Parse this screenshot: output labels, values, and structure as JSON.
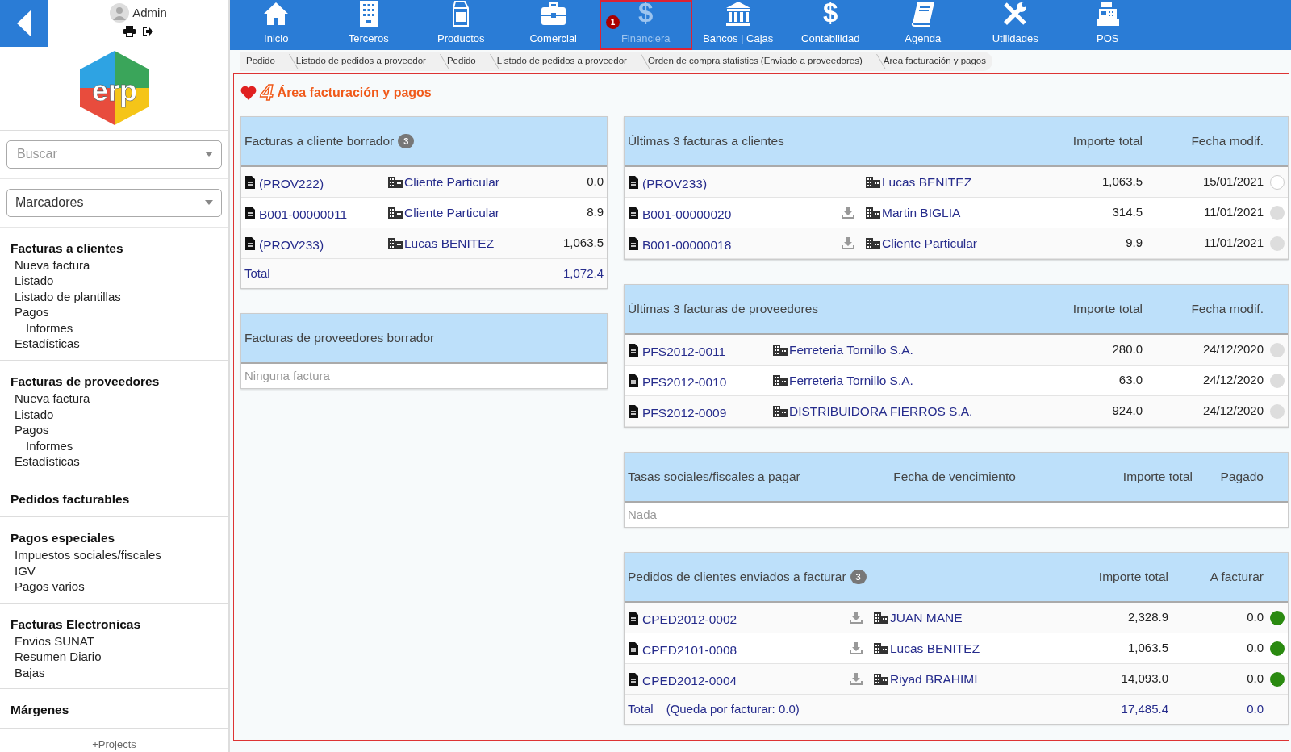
{
  "user": {
    "name": "Admin"
  },
  "logo": {
    "text": "erp"
  },
  "nav": [
    {
      "label": "Inicio",
      "kind": "house",
      "selected": false
    },
    {
      "label": "Terceros",
      "kind": "building",
      "selected": false
    },
    {
      "label": "Productos",
      "kind": "carton",
      "selected": false
    },
    {
      "label": "Comercial",
      "kind": "briefcase",
      "selected": false
    },
    {
      "label": "Financiera",
      "kind": "glyph",
      "glyph": "$",
      "selected": true,
      "badge": "1"
    },
    {
      "label": "Bancos | Cajas",
      "kind": "bank",
      "selected": false
    },
    {
      "label": "Contabilidad",
      "kind": "glyph",
      "glyph": "$",
      "selected": false
    },
    {
      "label": "Agenda",
      "kind": "book",
      "selected": false
    },
    {
      "label": "Utilidades",
      "kind": "tools",
      "selected": false
    },
    {
      "label": "POS",
      "kind": "register",
      "selected": false
    }
  ],
  "breadcrumb": [
    "Pedido",
    "Listado de pedidos a proveedor",
    "Pedido",
    "Listado de pedidos a proveedor",
    "Orden de compra statistics (Enviado a proveedores)",
    "Área facturación y pagos"
  ],
  "sidebar": {
    "search": {
      "placeholder": "Buscar"
    },
    "bookmarks": {
      "value": "Marcadores"
    },
    "sections": [
      {
        "title": "Facturas a clientes",
        "items": [
          {
            "label": "Nueva factura"
          },
          {
            "label": "Listado"
          },
          {
            "label": "Listado de plantillas"
          },
          {
            "label": "Pagos",
            "children": [
              {
                "label": "Informes"
              }
            ]
          },
          {
            "label": "Estadísticas"
          }
        ]
      },
      {
        "title": "Facturas de proveedores",
        "items": [
          {
            "label": "Nueva factura"
          },
          {
            "label": "Listado"
          },
          {
            "label": "Pagos",
            "children": [
              {
                "label": "Informes"
              }
            ]
          },
          {
            "label": "Estadísticas"
          }
        ]
      },
      {
        "title": "Pedidos facturables"
      },
      {
        "title": "Pagos especiales",
        "items": [
          {
            "label": "Impuestos sociales/fiscales"
          },
          {
            "label": "IGV"
          },
          {
            "label": "Pagos varios"
          }
        ]
      },
      {
        "title": "Facturas Electronicas",
        "items": [
          {
            "label": "Envios SUNAT"
          },
          {
            "label": "Resumen Diario"
          },
          {
            "label": "Bajas"
          }
        ]
      },
      {
        "title": "Márgenes"
      }
    ],
    "footer": "+Projects"
  },
  "page": {
    "title_glyph": "4",
    "title": "Área facturación y pagos"
  },
  "columns": [
    [
      {
        "kind": "drafts",
        "title": "Facturas a cliente borrador",
        "badge": "3",
        "rows": [
          {
            "ref": "(PROV222)",
            "company": "Cliente Particular",
            "values": [
              "0.0"
            ]
          },
          {
            "ref": "B001-00000011",
            "company": "Cliente Particular",
            "values": [
              "8.9"
            ]
          },
          {
            "ref": "(PROV233)",
            "company": "Lucas BENITEZ",
            "values": [
              "1,063.5"
            ]
          }
        ],
        "total": {
          "label": "Total",
          "values": [
            "1,072.4"
          ]
        }
      },
      {
        "kind": "drafts",
        "title": "Facturas de proveedores borrador",
        "empty": "Ninguna factura"
      }
    ],
    [
      {
        "kind": "clients",
        "title": "Últimas 3 facturas a clientes",
        "headers": [
          "Importe total",
          "Fecha modif."
        ],
        "rows": [
          {
            "ref": "(PROV233)",
            "download": false,
            "company": "Lucas BENITEZ",
            "values": [
              "1,063.5",
              "15/01/2021"
            ],
            "color": "#ffffff"
          },
          {
            "ref": "B001-00000020",
            "download": true,
            "company": "Martin BIGLIA",
            "values": [
              "314.5",
              "11/01/2021"
            ],
            "color": "#dddddd"
          },
          {
            "ref": "B001-00000018",
            "download": true,
            "company": "Cliente Particular",
            "values": [
              "9.9",
              "11/01/2021"
            ],
            "color": "#dddddd"
          }
        ]
      },
      {
        "kind": "suppliers",
        "title": "Últimas 3 facturas de proveedores",
        "headers": [
          "Importe total",
          "Fecha modif."
        ],
        "rows": [
          {
            "ref": "PFS2012-0011",
            "company": "Ferreteria Tornillo S.A.",
            "values": [
              "280.0",
              "24/12/2020"
            ],
            "color": "#dddddd"
          },
          {
            "ref": "PFS2012-0010",
            "company": "Ferreteria Tornillo S.A.",
            "values": [
              "63.0",
              "24/12/2020"
            ],
            "color": "#dddddd"
          },
          {
            "ref": "PFS2012-0009",
            "company": "DISTRIBUIDORA FIERROS S.A.",
            "values": [
              "924.0",
              "24/12/2020"
            ],
            "color": "#dddddd"
          }
        ]
      },
      {
        "kind": "taxes",
        "title": "Tasas sociales/fiscales a pagar",
        "headers": [
          "Fecha de vencimiento",
          "Importe total",
          "Pagado"
        ],
        "empty": "Nada"
      },
      {
        "kind": "orders",
        "title": "Pedidos de clientes enviados a facturar",
        "badge": "3",
        "headers": [
          "Importe total",
          "A facturar"
        ],
        "rows": [
          {
            "ref": "CPED2012-0002",
            "download": true,
            "company": "JUAN MANE",
            "values": [
              "2,328.9",
              "0.0"
            ],
            "color": "#2a8a10"
          },
          {
            "ref": "CPED2101-0008",
            "download": true,
            "company": "Lucas BENITEZ",
            "values": [
              "1,063.5",
              "0.0"
            ],
            "color": "#2a8a10"
          },
          {
            "ref": "CPED2012-0004",
            "download": true,
            "company": "Riyad BRAHIMI",
            "values": [
              "14,093.0",
              "0.0"
            ],
            "color": "#2a8a10"
          }
        ],
        "total": {
          "label": "Total",
          "note": "(Queda por facturar: 0.0)",
          "values": [
            "17,485.4",
            "0.0"
          ]
        }
      }
    ]
  ]
}
